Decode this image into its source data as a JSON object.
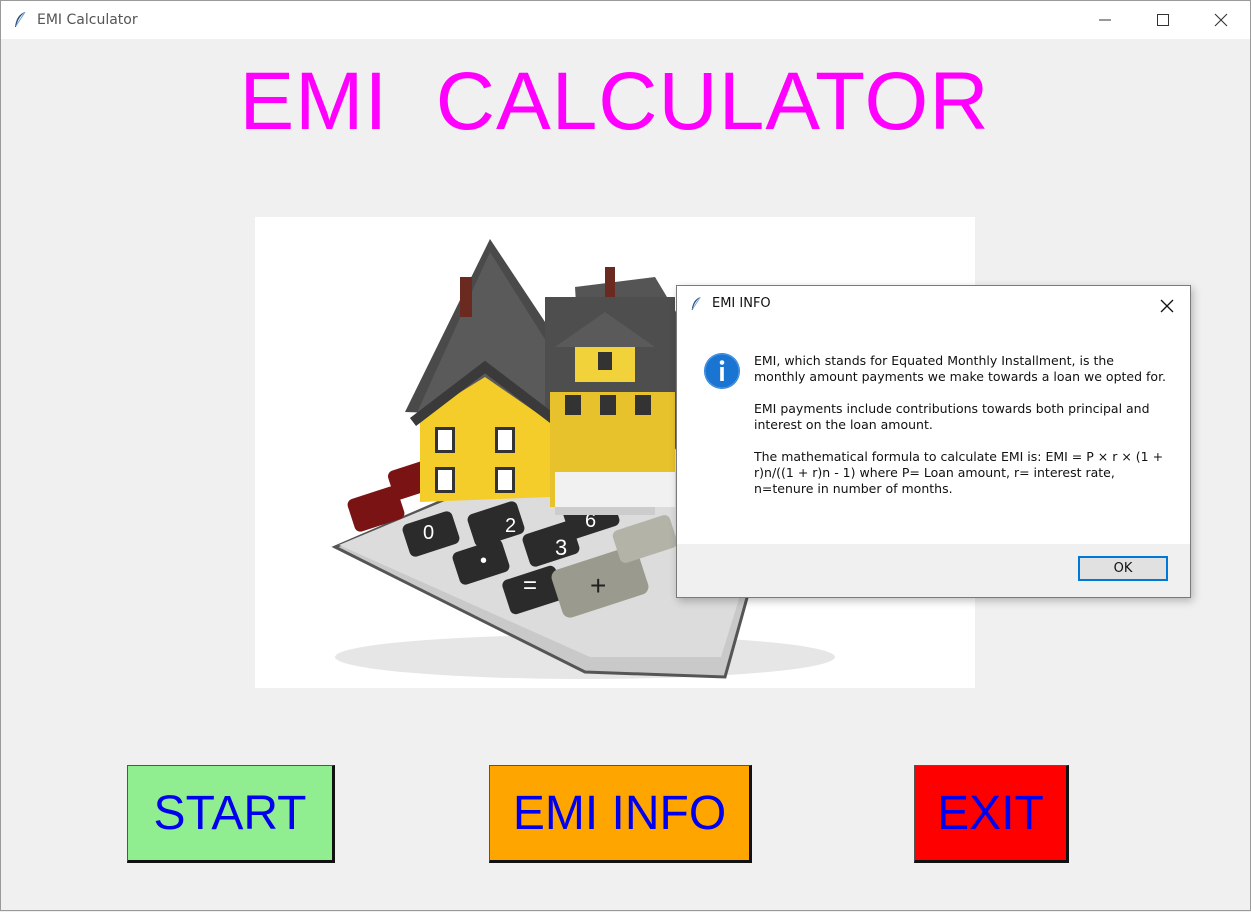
{
  "window": {
    "title": "EMI Calculator",
    "icon": "feather-icon"
  },
  "heading": "EMI  CALCULATOR",
  "illustration": "house-on-calculator-image",
  "buttons": {
    "start": "START",
    "info": "EMI INFO",
    "exit": "EXIT"
  },
  "colors": {
    "heading": "#ff00ff",
    "start_bg": "#90ee90",
    "info_bg": "#ffa500",
    "exit_bg": "#ff0000",
    "button_text": "#0000ee"
  },
  "dialog": {
    "title": "EMI INFO",
    "icon": "info-icon",
    "paragraphs": [
      "EMI, which stands for Equated Monthly Installment, is the monthly amount payments we make towards a loan we opted for.",
      "EMI payments include contributions towards both principal and interest on the loan amount.",
      "The mathematical formula to calculate EMI is: EMI = P × r × (1 + r)n/((1 + r)n - 1) where P= Loan amount, r= interest rate, n=tenure in number of months."
    ],
    "ok_label": "OK"
  }
}
